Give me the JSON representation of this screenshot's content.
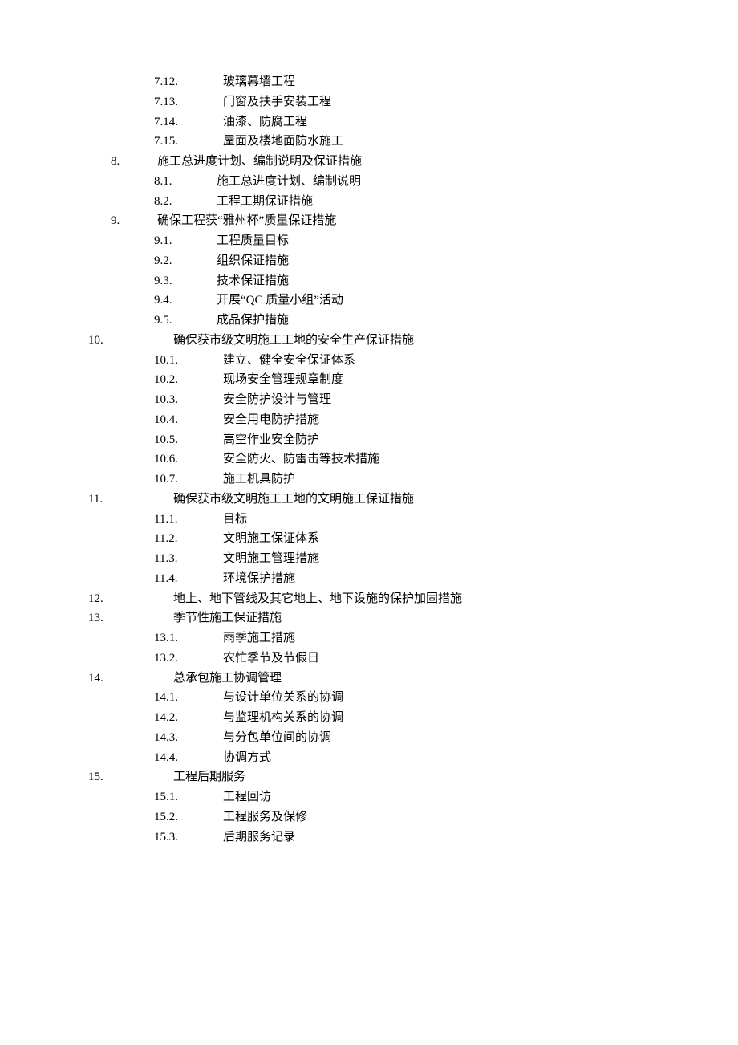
{
  "toc": [
    {
      "level": "lvl2",
      "numClass": "num-b",
      "num": "7.12.",
      "text": "玻璃幕墙工程"
    },
    {
      "level": "lvl2",
      "numClass": "num-b",
      "num": "7.13.",
      "text": "门窗及扶手安装工程"
    },
    {
      "level": "lvl2",
      "numClass": "num-b",
      "num": "7.14.",
      "text": "油漆、防腐工程"
    },
    {
      "level": "lvl2",
      "numClass": "num-b",
      "num": "7.15.",
      "text": "屋面及楼地面防水施工"
    },
    {
      "level": "lvl1",
      "numClass": "num-a",
      "num": "8.",
      "text": "施工总进度计划、编制说明及保证措施"
    },
    {
      "level": "lvl2",
      "numClass": "num-c",
      "num": "8.1.",
      "text": "施工总进度计划、编制说明"
    },
    {
      "level": "lvl2",
      "numClass": "num-c",
      "num": "8.2.",
      "text": "工程工期保证措施"
    },
    {
      "level": "lvl1",
      "numClass": "num-a",
      "num": "9.",
      "text": "确保工程获“雅州杯”质量保证措施"
    },
    {
      "level": "lvl2",
      "numClass": "num-c",
      "num": "9.1.",
      "text": "工程质量目标"
    },
    {
      "level": "lvl2",
      "numClass": "num-c",
      "num": "9.2.",
      "text": "组织保证措施"
    },
    {
      "level": "lvl2",
      "numClass": "num-c",
      "num": "9.3.",
      "text": "技术保证措施"
    },
    {
      "level": "lvl2",
      "numClass": "num-c",
      "num": "9.4.",
      "text": "开展“QC 质量小组”活动"
    },
    {
      "level": "lvl2",
      "numClass": "num-c",
      "num": "9.5.",
      "text": "成品保护措施"
    },
    {
      "level": "lvl1-wide",
      "numClass": "num-d",
      "num": "10.",
      "text": "确保获市级文明施工工地的安全生产保证措施"
    },
    {
      "level": "lvl2",
      "numClass": "num-b",
      "num": "10.1.",
      "text": "建立、健全安全保证体系"
    },
    {
      "level": "lvl2",
      "numClass": "num-b",
      "num": "10.2.",
      "text": "现场安全管理规章制度"
    },
    {
      "level": "lvl2",
      "numClass": "num-b",
      "num": "10.3.",
      "text": "安全防护设计与管理"
    },
    {
      "level": "lvl2",
      "numClass": "num-b",
      "num": "10.4.",
      "text": "安全用电防护措施"
    },
    {
      "level": "lvl2",
      "numClass": "num-b",
      "num": "10.5.",
      "text": "高空作业安全防护"
    },
    {
      "level": "lvl2",
      "numClass": "num-b",
      "num": "10.6.",
      "text": "安全防火、防雷击等技术措施"
    },
    {
      "level": "lvl2",
      "numClass": "num-b",
      "num": "10.7.",
      "text": "施工机具防护"
    },
    {
      "level": "lvl1-wide",
      "numClass": "num-d",
      "num": "11.",
      "text": "确保获市级文明施工工地的文明施工保证措施"
    },
    {
      "level": "lvl2",
      "numClass": "num-b",
      "num": "11.1.",
      "text": "目标"
    },
    {
      "level": "lvl2",
      "numClass": "num-b",
      "num": "11.2.",
      "text": "文明施工保证体系"
    },
    {
      "level": "lvl2",
      "numClass": "num-b",
      "num": "11.3.",
      "text": "文明施工管理措施"
    },
    {
      "level": "lvl2",
      "numClass": "num-b",
      "num": "11.4.",
      "text": "环境保护措施"
    },
    {
      "level": "lvl1-wide",
      "numClass": "num-d",
      "num": "12.",
      "text": "地上、地下管线及其它地上、地下设施的保护加固措施"
    },
    {
      "level": "lvl1-wide",
      "numClass": "num-d",
      "num": "13.",
      "text": "季节性施工保证措施"
    },
    {
      "level": "lvl2",
      "numClass": "num-b",
      "num": "13.1.",
      "text": "雨季施工措施"
    },
    {
      "level": "lvl2",
      "numClass": "num-b",
      "num": "13.2.",
      "text": "农忙季节及节假日"
    },
    {
      "level": "lvl1-wide",
      "numClass": "num-d",
      "num": "14.",
      "text": "总承包施工协调管理"
    },
    {
      "level": "lvl2",
      "numClass": "num-b",
      "num": "14.1.",
      "text": "与设计单位关系的协调"
    },
    {
      "level": "lvl2",
      "numClass": "num-b",
      "num": "14.2.",
      "text": "与监理机构关系的协调"
    },
    {
      "level": "lvl2",
      "numClass": "num-b",
      "num": "14.3.",
      "text": "与分包单位间的协调"
    },
    {
      "level": "lvl2",
      "numClass": "num-b",
      "num": "14.4.",
      "text": "协调方式"
    },
    {
      "level": "lvl1-wide",
      "numClass": "num-d",
      "num": "15.",
      "text": "工程后期服务"
    },
    {
      "level": "lvl2",
      "numClass": "num-b",
      "num": "15.1.",
      "text": "工程回访"
    },
    {
      "level": "lvl2",
      "numClass": "num-b",
      "num": "15.2.",
      "text": "工程服务及保修"
    },
    {
      "level": "lvl2",
      "numClass": "num-b",
      "num": "15.3.",
      "text": "后期服务记录"
    }
  ]
}
